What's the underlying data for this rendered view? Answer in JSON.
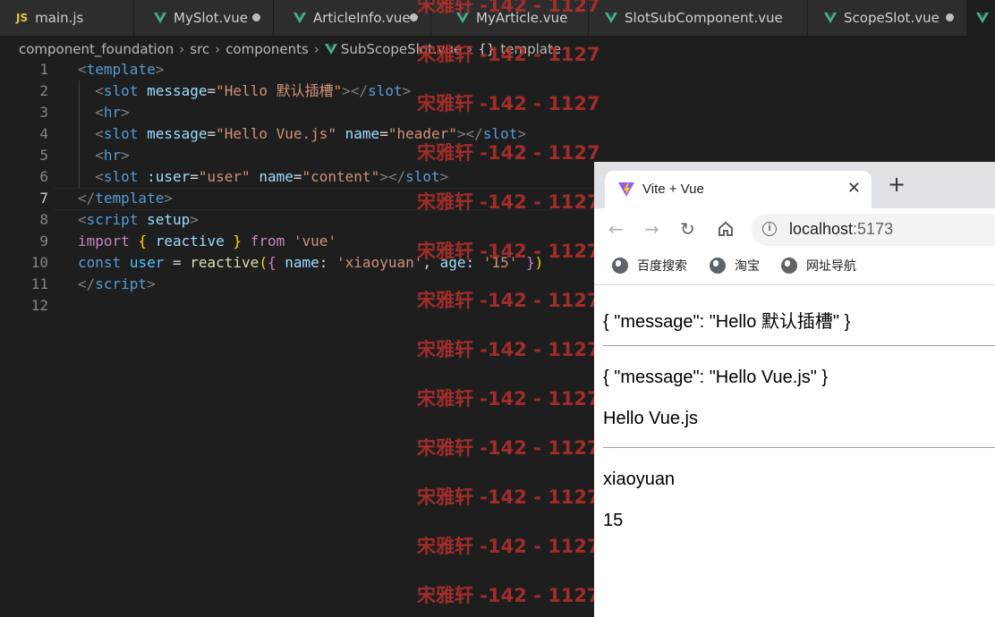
{
  "tabs": [
    {
      "label": "main.js",
      "icon": "js-icon",
      "modified": false
    },
    {
      "label": "MySlot.vue",
      "icon": "vue-icon",
      "modified": true
    },
    {
      "label": "ArticleInfo.vue",
      "icon": "vue-icon",
      "modified": true
    },
    {
      "label": "MyArticle.vue",
      "icon": "vue-icon",
      "modified": false
    },
    {
      "label": "SlotSubComponent.vue",
      "icon": "vue-icon",
      "modified": false
    },
    {
      "label": "ScopeSlot.vue",
      "icon": "vue-icon",
      "modified": true
    }
  ],
  "breadcrumb": {
    "items": [
      "component_foundation",
      "src",
      "components",
      "SubScopeSlot.vue",
      "template"
    ],
    "template_icon": "{}"
  },
  "editor": {
    "line_numbers": [
      "1",
      "2",
      "3",
      "4",
      "5",
      "6",
      "7",
      "8",
      "9",
      "10",
      "11",
      "12"
    ],
    "current_line": "7"
  },
  "watermark": {
    "text": "宋雅轩 -142 - 1127",
    "color": "#b3302c"
  },
  "browser": {
    "tab_title": "Vite + Vue",
    "close_glyph": "✕",
    "new_tab_glyph": "+",
    "url_host": "localhost",
    "url_port": ":5173",
    "bookmarks": [
      "百度搜索",
      "淘宝",
      "网址导航"
    ]
  },
  "page": {
    "line1": "{ \"message\": \"Hello 默认插槽\" }",
    "line2": "{ \"message\": \"Hello Vue.js\" }",
    "line3": "Hello Vue.js",
    "line4": "xiaoyuan",
    "line5": "15"
  },
  "colors": {
    "editor_bg": "#1e1e1e",
    "vue_green": "#41b883",
    "tag_blue": "#569cd6",
    "attr_blue": "#9cdcfe",
    "string_orange": "#ce9178"
  }
}
